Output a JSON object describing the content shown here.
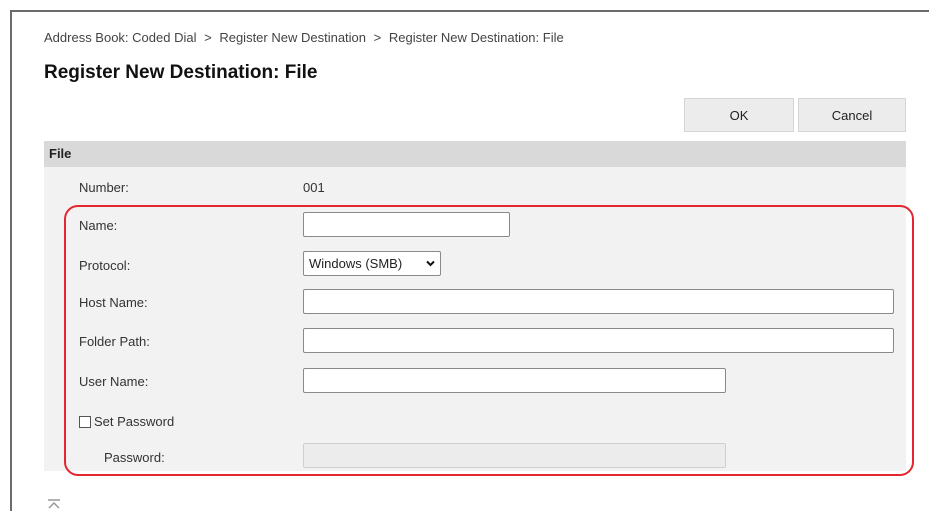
{
  "breadcrumb": {
    "items": [
      "Address Book: Coded Dial",
      "Register New Destination",
      "Register New Destination: File"
    ],
    "separator": ">"
  },
  "page_title": "Register New Destination: File",
  "buttons": {
    "ok": "OK",
    "cancel": "Cancel"
  },
  "section": {
    "title": "File",
    "number_label": "Number:",
    "number_value": "001",
    "name_label": "Name:",
    "name_value": "",
    "protocol_label": "Protocol:",
    "protocol_value": "Windows (SMB)",
    "host_label": "Host Name:",
    "host_value": "",
    "folder_label": "Folder Path:",
    "folder_value": "",
    "user_label": "User Name:",
    "user_value": "",
    "set_password_label": "Set Password",
    "set_password_checked": false,
    "password_label": "Password:",
    "password_value": ""
  },
  "colors": {
    "highlight": "#e3262f",
    "section_header": "#d9d9d9",
    "section_body": "#f2f2f2",
    "button_bg": "#ececec"
  },
  "icons": {
    "protocol_dropdown": "chevron-down-icon",
    "scroll_to_top": "scroll-to-top-icon"
  }
}
